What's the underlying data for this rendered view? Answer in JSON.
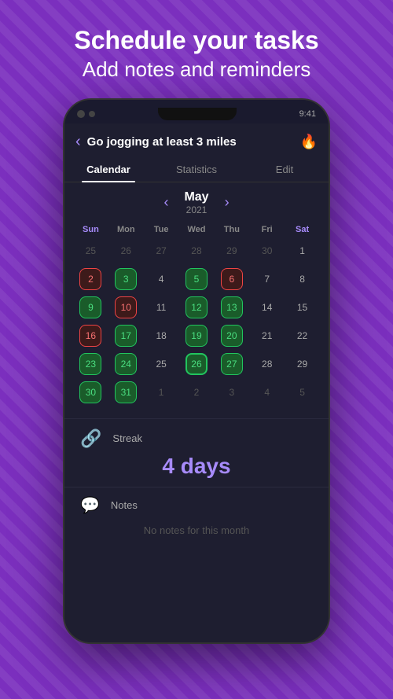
{
  "header": {
    "line1": "Schedule your tasks",
    "line2": "Add notes and reminders"
  },
  "phone": {
    "time": "9:41"
  },
  "task": {
    "title": "Go jogging at least 3 miles",
    "back_label": "‹",
    "fire_icon": "🔥"
  },
  "tabs": [
    {
      "id": "calendar",
      "label": "Calendar",
      "active": true
    },
    {
      "id": "statistics",
      "label": "Statistics",
      "active": false
    },
    {
      "id": "edit",
      "label": "Edit",
      "active": false
    }
  ],
  "calendar": {
    "month_name": "May",
    "year": "2021",
    "prev_icon": "‹",
    "next_icon": "›",
    "day_headers": [
      {
        "label": "Sun",
        "type": "sun"
      },
      {
        "label": "Mon",
        "type": "weekday"
      },
      {
        "label": "Tue",
        "type": "weekday"
      },
      {
        "label": "Wed",
        "type": "weekday"
      },
      {
        "label": "Thu",
        "type": "weekday"
      },
      {
        "label": "Fri",
        "type": "weekday"
      },
      {
        "label": "Sat",
        "type": "sat"
      }
    ],
    "days": [
      {
        "num": "25",
        "type": "empty"
      },
      {
        "num": "26",
        "type": "empty"
      },
      {
        "num": "27",
        "type": "empty"
      },
      {
        "num": "28",
        "type": "empty"
      },
      {
        "num": "29",
        "type": "empty"
      },
      {
        "num": "30",
        "type": "empty"
      },
      {
        "num": "1",
        "type": "normal"
      },
      {
        "num": "2",
        "type": "red"
      },
      {
        "num": "3",
        "type": "green"
      },
      {
        "num": "4",
        "type": "normal"
      },
      {
        "num": "5",
        "type": "green"
      },
      {
        "num": "6",
        "type": "red"
      },
      {
        "num": "7",
        "type": "normal"
      },
      {
        "num": "8",
        "type": "normal"
      },
      {
        "num": "9",
        "type": "green"
      },
      {
        "num": "10",
        "type": "red"
      },
      {
        "num": "11",
        "type": "normal"
      },
      {
        "num": "12",
        "type": "green"
      },
      {
        "num": "13",
        "type": "green"
      },
      {
        "num": "14",
        "type": "normal"
      },
      {
        "num": "15",
        "type": "normal"
      },
      {
        "num": "16",
        "type": "red"
      },
      {
        "num": "17",
        "type": "green"
      },
      {
        "num": "18",
        "type": "normal"
      },
      {
        "num": "19",
        "type": "green"
      },
      {
        "num": "20",
        "type": "green"
      },
      {
        "num": "21",
        "type": "normal"
      },
      {
        "num": "22",
        "type": "normal"
      },
      {
        "num": "23",
        "type": "green"
      },
      {
        "num": "24",
        "type": "green"
      },
      {
        "num": "25",
        "type": "normal"
      },
      {
        "num": "26",
        "type": "today-green"
      },
      {
        "num": "27",
        "type": "green"
      },
      {
        "num": "28",
        "type": "normal"
      },
      {
        "num": "29",
        "type": "normal"
      },
      {
        "num": "30",
        "type": "green"
      },
      {
        "num": "31",
        "type": "green"
      },
      {
        "num": "1",
        "type": "empty"
      },
      {
        "num": "2",
        "type": "empty"
      },
      {
        "num": "3",
        "type": "empty"
      },
      {
        "num": "4",
        "type": "empty"
      },
      {
        "num": "5",
        "type": "empty"
      }
    ]
  },
  "streak": {
    "icon": "🔗",
    "label": "Streak",
    "value": "4 days"
  },
  "notes": {
    "icon": "💬",
    "label": "Notes",
    "empty_message": "No notes for this month"
  }
}
